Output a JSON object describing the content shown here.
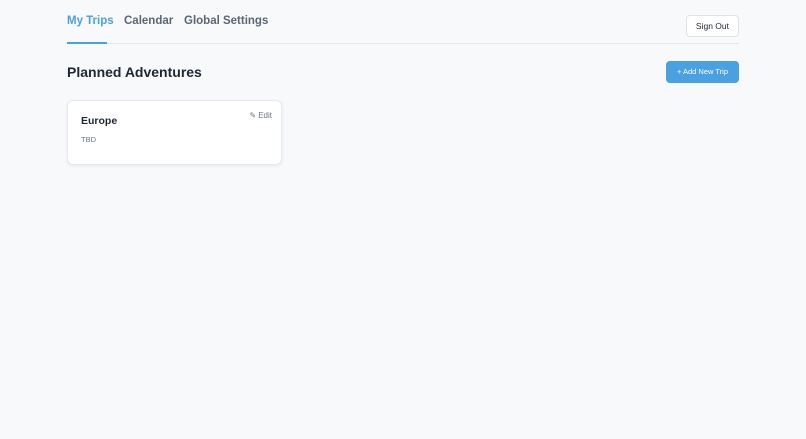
{
  "nav": {
    "tabs": [
      {
        "label": "My Trips",
        "active": true
      },
      {
        "label": "Calendar",
        "active": false
      },
      {
        "label": "Global Settings",
        "active": false
      }
    ],
    "sign_out_label": "Sign Out"
  },
  "main": {
    "title": "Planned Adventures",
    "add_button_label": "+ Add New Trip",
    "trips": [
      {
        "name": "Europe",
        "dates": "TBD",
        "edit_label": "Edit",
        "edit_icon": "✎"
      }
    ]
  },
  "colors": {
    "accent": "#4aa0e0",
    "background": "#f7f9fb",
    "text": "#1f2733",
    "muted": "#6b7684"
  }
}
